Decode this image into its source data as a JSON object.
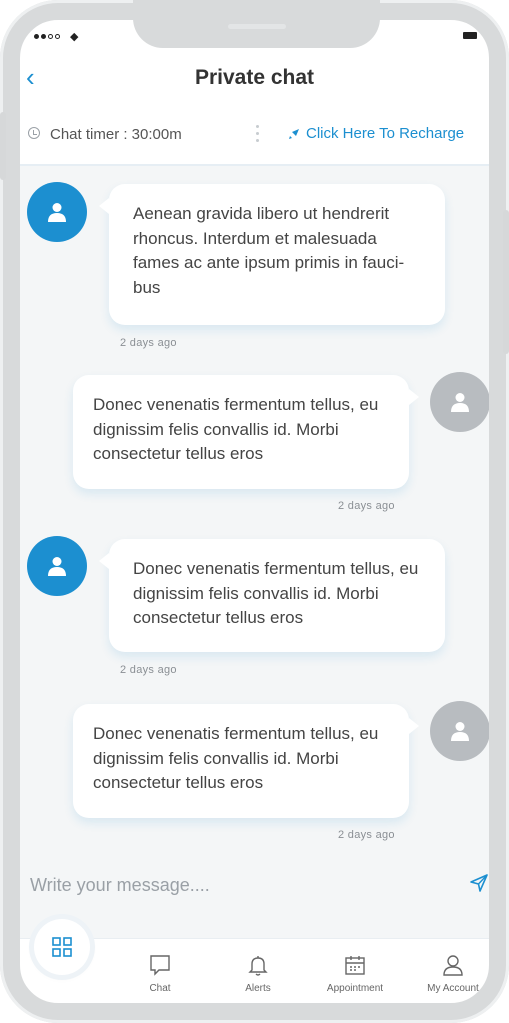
{
  "header": {
    "title": "Private chat",
    "back_icon": "back-chevron-icon"
  },
  "timer": {
    "label": "Chat timer : 30:00m",
    "recharge_label": "Click Here To Recharge"
  },
  "messages": [
    {
      "side": "left",
      "text": "Aenean gravida libero ut hendrerit rhoncus. Interdum et malesuada fames ac ante ipsum primis in fauci-bus",
      "time": "2 days ago"
    },
    {
      "side": "right",
      "text": "Donec venenatis fermentum tellus, eu dignissim felis convallis id. Morbi consectetur tellus eros",
      "time": "2 days ago"
    },
    {
      "side": "left",
      "text": "Donec venenatis fermentum tellus, eu dignissim felis convallis id. Morbi consectetur tellus eros",
      "time": "2 days ago"
    },
    {
      "side": "right",
      "text": "Donec venenatis fermentum tellus, eu dignissim felis convallis id. Morbi consectetur tellus eros",
      "time": "2 days ago"
    }
  ],
  "composer": {
    "placeholder": "Write your message...."
  },
  "nav": {
    "items": [
      {
        "label": "Chat",
        "icon": "chat-icon"
      },
      {
        "label": "Alerts",
        "icon": "bell-icon"
      },
      {
        "label": "Appointment",
        "icon": "calendar-icon"
      },
      {
        "label": "My Account",
        "icon": "user-icon"
      }
    ]
  },
  "colors": {
    "accent": "#1c8fd0",
    "avatar_other": "#b8bcc0",
    "background": "#f4f6f7"
  }
}
